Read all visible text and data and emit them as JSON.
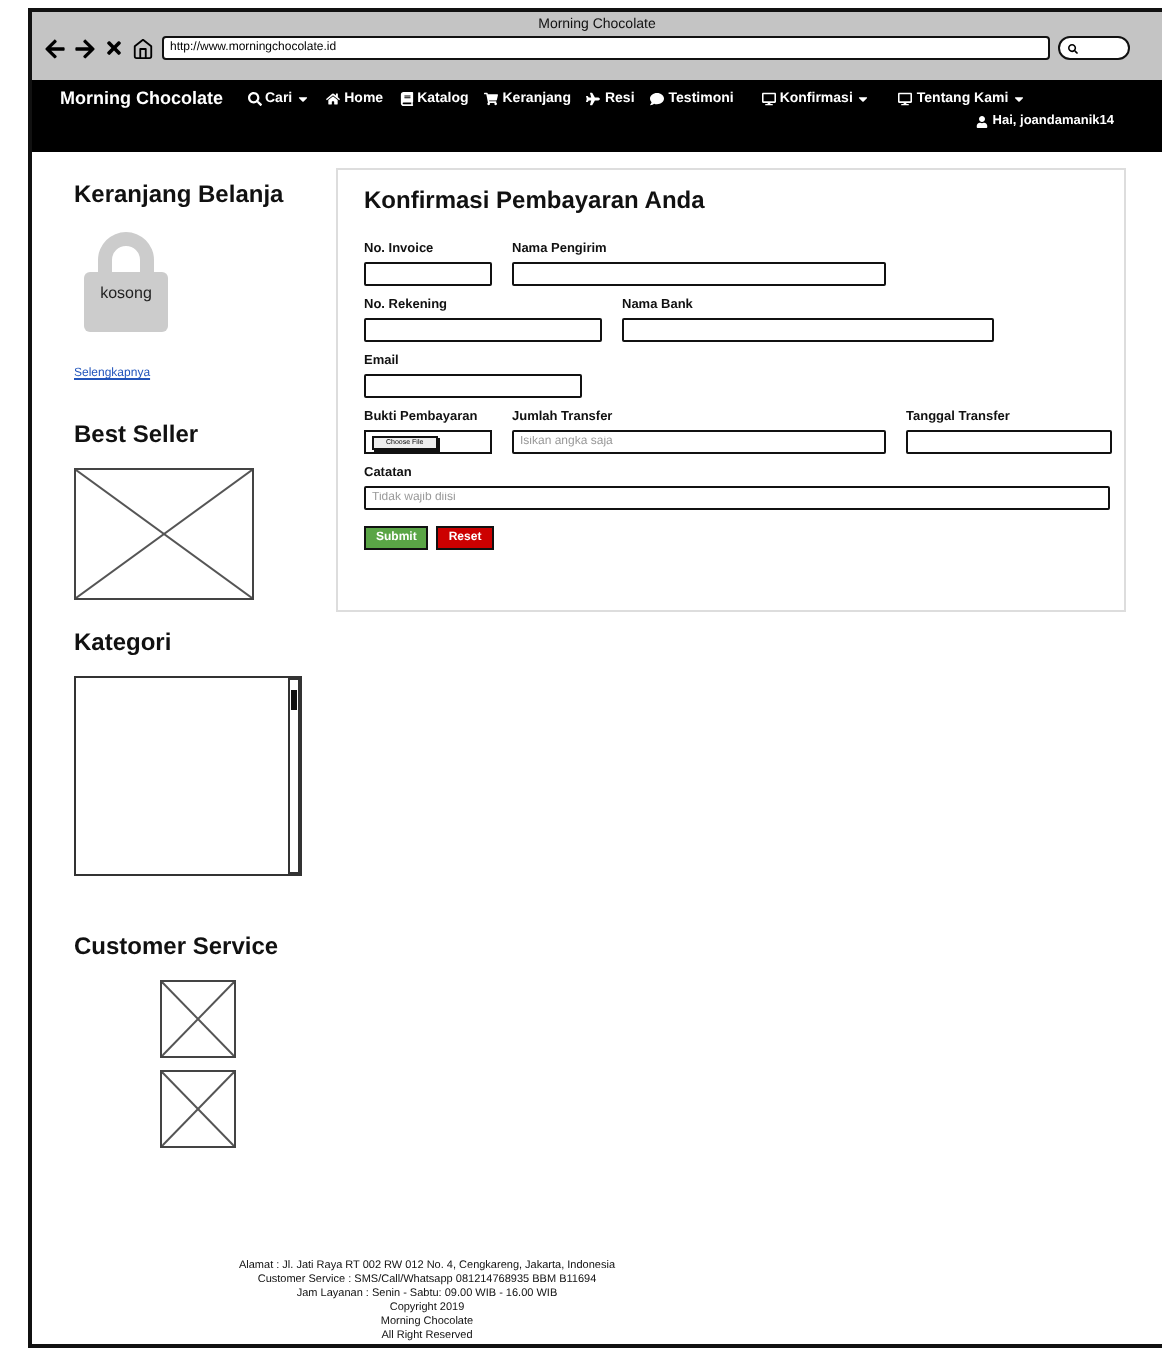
{
  "window": {
    "title": "Morning Chocolate",
    "url": "http://www.morningchocolate.id"
  },
  "navbar": {
    "brand": "Morning Chocolate",
    "items": [
      {
        "label": "Cari",
        "dropdown": true
      },
      {
        "label": "Home",
        "dropdown": false
      },
      {
        "label": "Katalog",
        "dropdown": false
      },
      {
        "label": "Keranjang",
        "dropdown": false
      },
      {
        "label": "Resi",
        "dropdown": false
      },
      {
        "label": "Testimoni",
        "dropdown": false
      },
      {
        "label": "Konfirmasi",
        "dropdown": true
      },
      {
        "label": "Tentang Kami",
        "dropdown": true
      }
    ],
    "user": "Hai, joandamanik14"
  },
  "sidebar": {
    "cart": {
      "title": "Keranjang Belanja",
      "status": "kosong",
      "link": "Selengkapnya"
    },
    "best_seller": {
      "title": "Best Seller"
    },
    "category": {
      "title": "Kategori"
    },
    "customer_service": {
      "title": "Customer Service"
    }
  },
  "form": {
    "title": "Konfirmasi Pembayaran Anda",
    "rows": [
      [
        {
          "label": "No. Invoice",
          "kind": "text"
        },
        {
          "label": "Nama Pengirim",
          "kind": "text"
        }
      ],
      [
        {
          "label": "No. Rekening",
          "kind": "text"
        },
        {
          "label": "Nama Bank",
          "kind": "text"
        }
      ],
      [
        {
          "label": "Email",
          "kind": "text"
        }
      ],
      [
        {
          "label": "Bukti Pembayaran",
          "kind": "file",
          "button": "Choose File"
        },
        {
          "label": "Jumlah Transfer",
          "kind": "text",
          "placeholder": "Isikan angka saja"
        },
        {
          "label": "Tanggal Transfer",
          "kind": "text"
        }
      ],
      [
        {
          "label": "Catatan",
          "kind": "text",
          "placeholder": "Tidak wajib diisi"
        }
      ]
    ],
    "buttons": [
      {
        "label": "Submit",
        "kind": "submit"
      },
      {
        "label": "Reset",
        "kind": "reset"
      }
    ]
  },
  "footer": [
    "Alamat : Jl. Jati Raya RT 002 RW 012 No. 4, Cengkareng, Jakarta, Indonesia",
    "Customer Service : SMS/Call/Whatsapp 081214768935 BBM B11694",
    "Jam Layanan : Senin - Sabtu: 09.00 WIB - 16.00 WIB",
    "Copyright 2019",
    "Morning Chocolate",
    "All Right Reserved"
  ]
}
